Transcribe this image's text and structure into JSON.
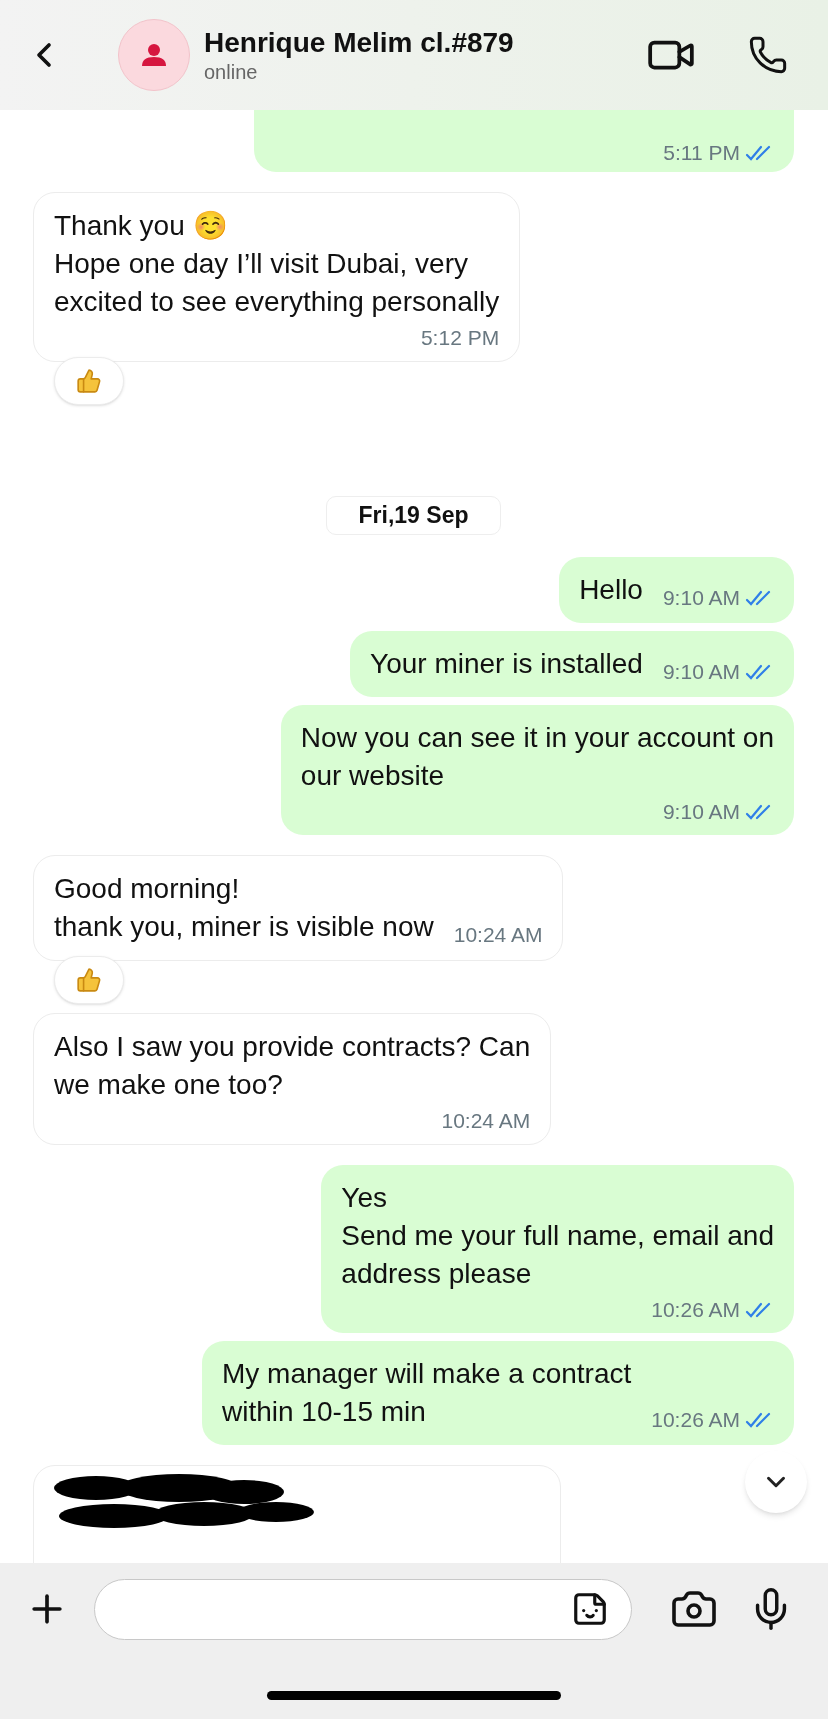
{
  "header": {
    "name": "Henrique Melim cl.#879",
    "status": "online"
  },
  "messages": [
    {
      "kind": "outgoing",
      "time": "5:11 PM",
      "read": true
    },
    {
      "kind": "incoming",
      "text": "Thank you ☺️\nHope one day I’ll visit Dubai, very\nexcited to see everything personally",
      "time": "5:12 PM",
      "reaction": true
    },
    {
      "kind": "date",
      "text": "Fri,19 Sep"
    },
    {
      "kind": "outgoing",
      "text": "Hello",
      "time": "9:10 AM",
      "read": true
    },
    {
      "kind": "outgoing",
      "text": "Your miner is installed",
      "time": "9:10 AM",
      "read": true
    },
    {
      "kind": "outgoing",
      "text": "Now you can see it in your account on\nour website",
      "time": "9:10 AM",
      "read": true
    },
    {
      "kind": "incoming",
      "text": "Good morning!\nthank you, miner is visible now",
      "time": "10:24 AM",
      "reaction": true
    },
    {
      "kind": "incoming",
      "text": "Also I saw you provide contracts? Can\nwe make one too?",
      "time": "10:24 AM",
      "reaction": false
    },
    {
      "kind": "outgoing",
      "text": "Yes\nSend me your full name, email and\naddress please",
      "time": "10:26 AM",
      "read": true
    },
    {
      "kind": "outgoing",
      "text": "My manager will make a contract\nwithin 10-15 min",
      "time": "10:26 AM",
      "read": true
    },
    {
      "kind": "incoming",
      "redacted": true
    }
  ]
}
